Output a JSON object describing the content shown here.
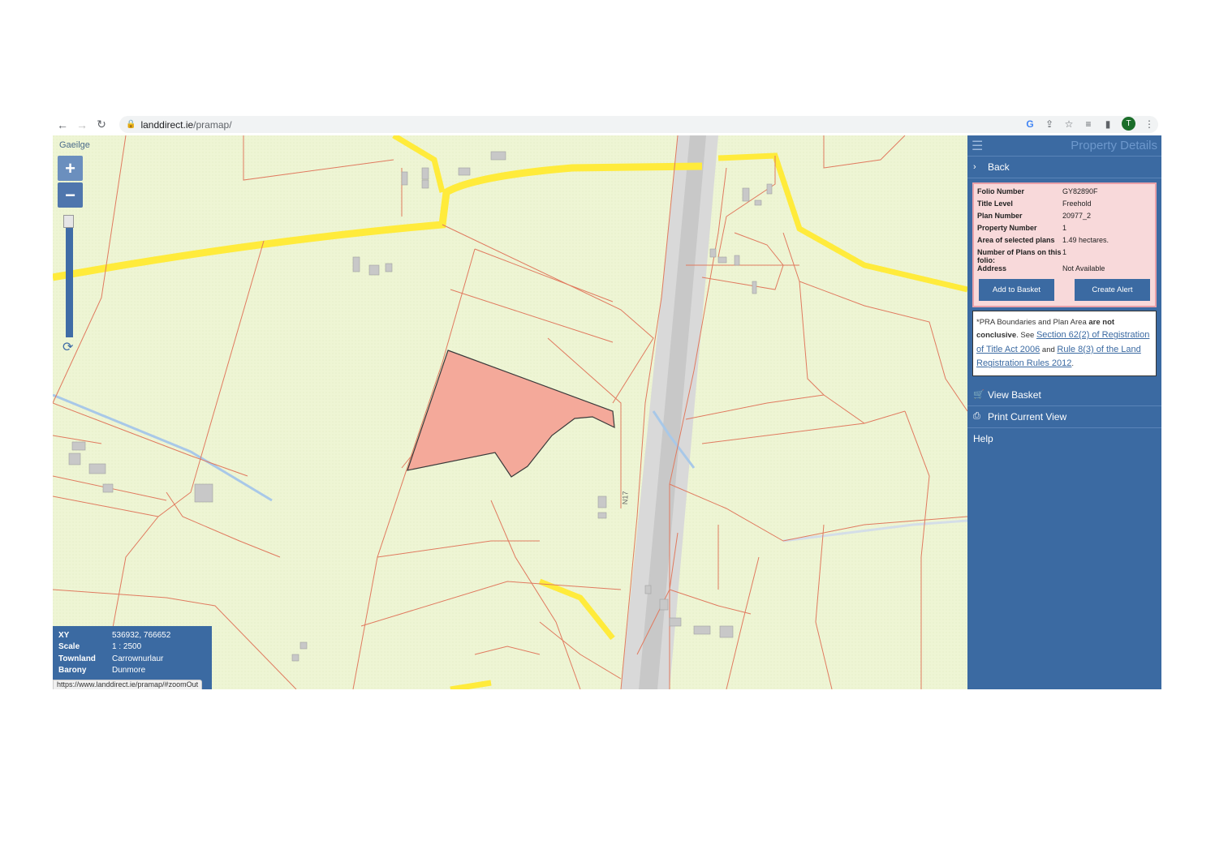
{
  "browser": {
    "url_host": "landdirect.ie",
    "url_path": "/pramap/",
    "profile_initial": "T"
  },
  "map": {
    "language_link": "Gaeilge",
    "zoom_in": "+",
    "zoom_out": "−",
    "road_label": "N17",
    "info": {
      "xy_label": "XY",
      "xy_value": "536932, 766652",
      "scale_label": "Scale",
      "scale_value": "1 : 2500",
      "townland_label": "Townland",
      "townland_value": "Carrownurlaur",
      "barony_label": "Barony",
      "barony_value": "Dunmore"
    },
    "status_url": "https://www.landdirect.ie/pramap/#zoomOut",
    "colors": {
      "background": "#eef5d4",
      "boundary": "#e07a5f",
      "road": "#ffeb3b",
      "selected_plot": "#f4a99a"
    }
  },
  "sidebar": {
    "title": "Property Details",
    "back": "Back",
    "details": [
      {
        "label": "Folio Number",
        "value": "GY82890F"
      },
      {
        "label": "Title Level",
        "value": "Freehold"
      },
      {
        "label": "Plan Number",
        "value": "20977_2"
      },
      {
        "label": "Property Number",
        "value": "1"
      },
      {
        "label": "Area of selected plans",
        "value": "1.49 hectares."
      },
      {
        "label": "Number of Plans on this folio:",
        "value": "1"
      },
      {
        "label": "Address",
        "value": "Not Available"
      }
    ],
    "add_to_basket": "Add to Basket",
    "create_alert": "Create Alert",
    "notice": {
      "prefix": "*PRA Boundaries and Plan Area ",
      "bold": "are not conclusive",
      "see": ". See ",
      "link1": "Section 62(2) of Registration of Title Act 2006",
      "and": " and ",
      "link2": "Rule 8(3) of the Land Registration Rules 2012",
      "end": "."
    },
    "view_basket": "View Basket",
    "print_view": "Print Current View",
    "help": "Help"
  }
}
